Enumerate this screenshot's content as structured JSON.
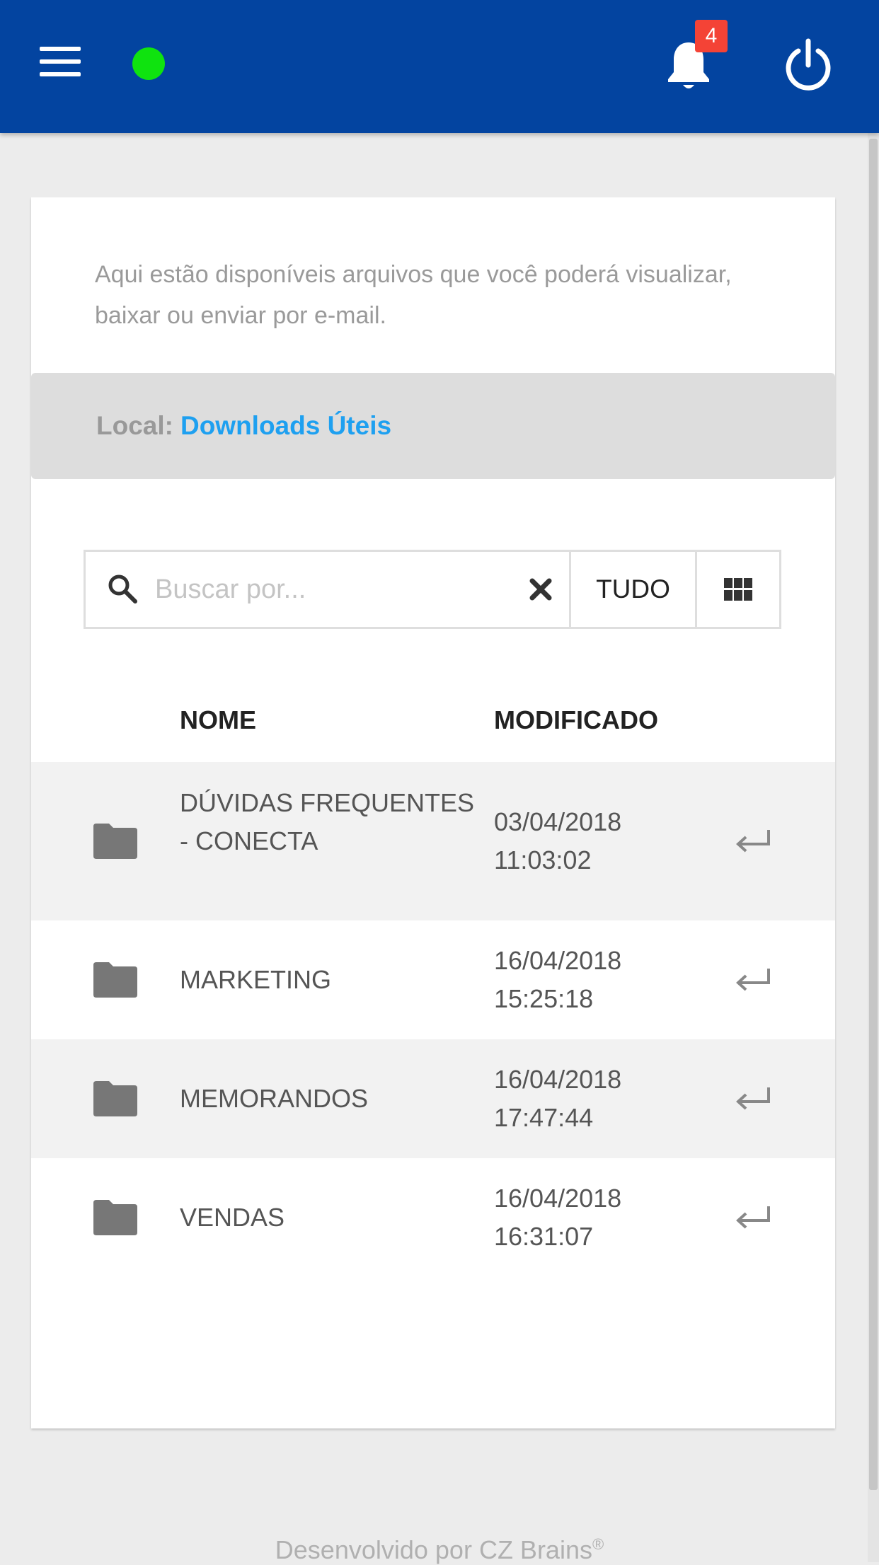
{
  "header": {
    "menu_icon": "hamburger-menu-icon",
    "status_color": "#0fe30f",
    "notifications": {
      "icon": "bell-icon",
      "count": "4",
      "badge_color": "#f44336"
    },
    "power_icon": "power-icon"
  },
  "main": {
    "intro_text": "Aqui estão disponíveis arquivos que você poderá visualizar, baixar ou enviar por e-mail.",
    "location": {
      "label": "Local:",
      "value": "Downloads Úteis"
    },
    "search": {
      "placeholder": "Buscar por...",
      "value": "",
      "clear_icon": "close-x-icon",
      "filter_label": "TUDO",
      "view_icon": "grid-view-icon"
    },
    "table": {
      "headers": {
        "name": "NOME",
        "modified": "MODIFICADO"
      },
      "rows": [
        {
          "name": "DÚVIDAS FREQUENTES - CONECTA",
          "date": "03/04/2018",
          "time": "11:03:02"
        },
        {
          "name": "MARKETING",
          "date": "16/04/2018",
          "time": "15:25:18"
        },
        {
          "name": "MEMORANDOS",
          "date": "16/04/2018",
          "time": "17:47:44"
        },
        {
          "name": "VENDAS",
          "date": "16/04/2018",
          "time": "16:31:07"
        }
      ]
    }
  },
  "footer": {
    "text": "Desenvolvido por CZ Brains",
    "mark": "®"
  },
  "colors": {
    "header_bg": "#0344a0",
    "link": "#1ea0f0"
  }
}
